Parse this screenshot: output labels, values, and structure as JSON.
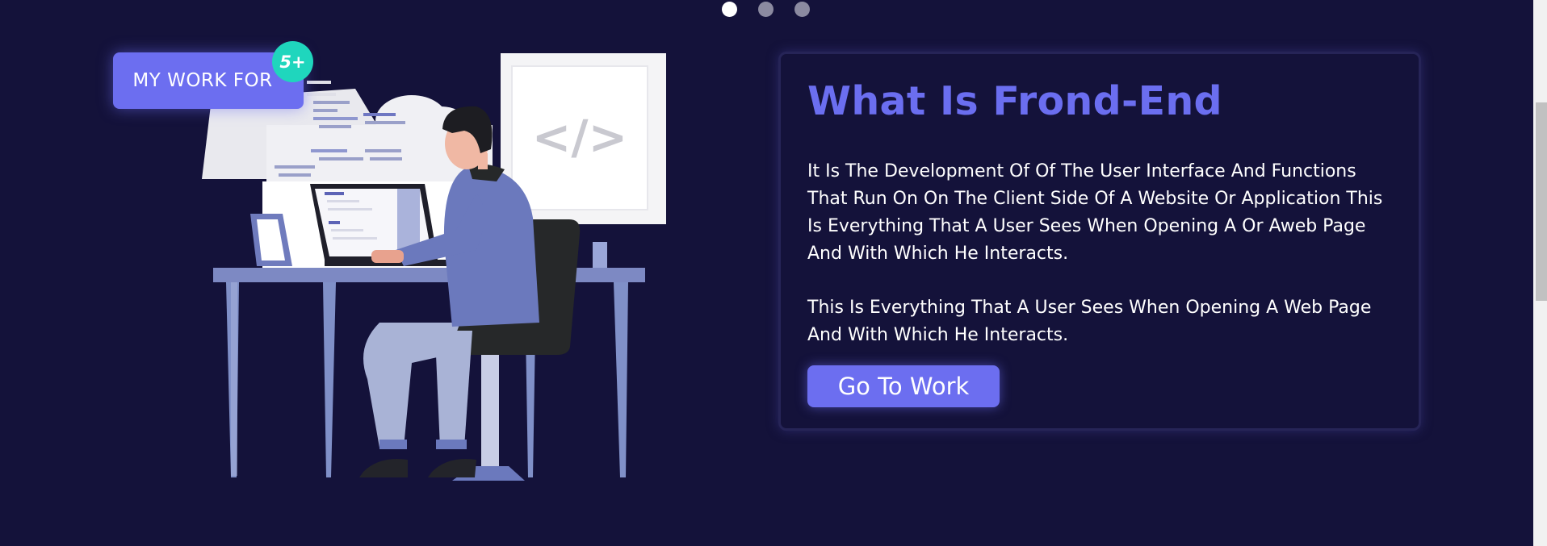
{
  "carousel": {
    "active_index": 0,
    "slide_count": 3
  },
  "badge": {
    "label": "MY WORK FOR",
    "count": "5+"
  },
  "illustration": {
    "code_icon": "</>"
  },
  "card": {
    "title": "What Is Frond-End",
    "paragraph1": "It Is The Development Of Of The User Interface And Functions That Run On On The Client Side Of A Website Or Application This Is Everything That A User Sees When Opening A Or Aweb Page And With Which He Interacts.",
    "paragraph2": "This Is Everything That A User Sees When Opening A Web Page And With Which He Interacts.",
    "button_label": "Go To Work"
  },
  "colors": {
    "background": "#14123a",
    "accent": "#6c6ef0",
    "badge_teal": "#1fd6bd",
    "dot_inactive": "#8b8aa0",
    "dot_active": "#ffffff"
  }
}
